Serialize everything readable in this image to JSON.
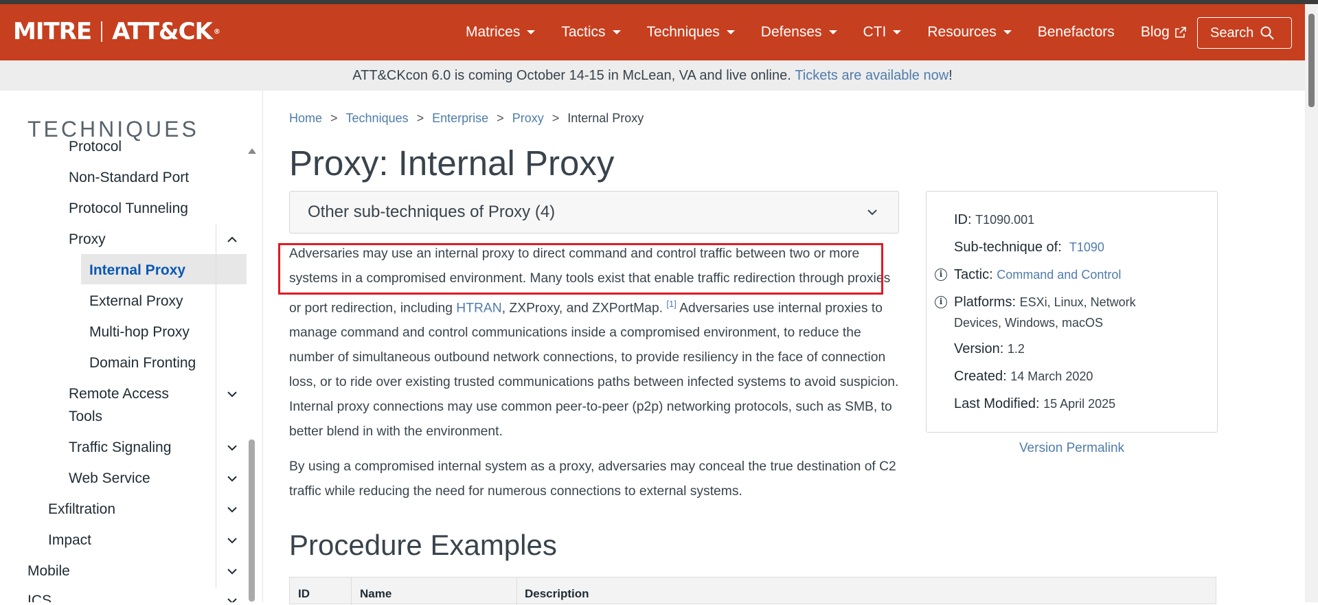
{
  "header": {
    "logo_mitre": "MITRE",
    "logo_attack": "ATT&CK",
    "logo_reg": "®",
    "nav": [
      {
        "label": "Matrices",
        "dropdown": true
      },
      {
        "label": "Tactics",
        "dropdown": true
      },
      {
        "label": "Techniques",
        "dropdown": true
      },
      {
        "label": "Defenses",
        "dropdown": true
      },
      {
        "label": "CTI",
        "dropdown": true
      },
      {
        "label": "Resources",
        "dropdown": true
      },
      {
        "label": "Benefactors",
        "dropdown": false
      },
      {
        "label": "Blog",
        "dropdown": false
      }
    ],
    "search_label": "Search",
    "brand_color": "#c63f1f"
  },
  "banner": {
    "text": "ATT&CKcon 6.0 is coming October 14-15 in McLean, VA and live online. ",
    "link": "Tickets are available now",
    "suffix": "!"
  },
  "sidebar": {
    "title": "TECHNIQUES",
    "items": [
      {
        "label": "Protocol"
      },
      {
        "label": "Non-Standard Port"
      },
      {
        "label": "Protocol Tunneling"
      },
      {
        "label": "Proxy"
      },
      {
        "label": "Internal Proxy",
        "active": true
      },
      {
        "label": "External Proxy"
      },
      {
        "label": "Multi-hop Proxy"
      },
      {
        "label": "Domain Fronting"
      },
      {
        "label": "Remote Access"
      },
      {
        "label": "Tools"
      },
      {
        "label": "Traffic Signaling"
      },
      {
        "label": "Web Service"
      },
      {
        "label": "Exfiltration"
      },
      {
        "label": "Impact"
      },
      {
        "label": "Mobile"
      },
      {
        "label": "ICS"
      }
    ]
  },
  "breadcrumb": {
    "items": [
      "Home",
      "Techniques",
      "Enterprise",
      "Proxy"
    ],
    "current": "Internal Proxy",
    "sep": ">"
  },
  "page": {
    "title": "Proxy: Internal Proxy",
    "accordion_label": "Other sub-techniques of Proxy (4)",
    "desc_part1": "Adversaries may use an internal proxy to direct command and control traffic between two or more systems in a compromised environment. Many tools exist that enable traffic redirection through proxies or port redirection, including ",
    "desc_link": "HTRAN",
    "desc_part2": ", ZXProxy, and ZXPortMap. ",
    "desc_ref": "[1]",
    "desc_part3": " Adversaries use internal proxies to manage command and control communications inside a compromised environment, to reduce the number of simultaneous outbound network connections, to provide resiliency in the face of connection loss, or to ride over existing trusted communications paths between infected systems to avoid suspicion. Internal proxy connections may use common peer-to-peer (p2p) networking protocols, such as SMB, to better blend in with the environment.",
    "desc2": "By using a compromised internal system as a proxy, adversaries may conceal the true destination of C2 traffic while reducing the need for numerous connections to external systems.",
    "procedure_heading": "Procedure Examples",
    "table_headers": [
      "ID",
      "Name",
      "Description"
    ]
  },
  "card": {
    "id_label": "ID:",
    "id_value": "T1090.001",
    "sub_label": "Sub-technique of:",
    "sub_value": "T1090",
    "tactic_label": "Tactic:",
    "tactic_value": "Command and Control",
    "platforms_label": "Platforms:",
    "platforms_line1": "ESXi, Linux, Network",
    "platforms_line2": "Devices, Windows, macOS",
    "version_label": "Version:",
    "version_value": "1.2",
    "created_label": "Created:",
    "created_value": "14 March 2020",
    "modified_label": "Last Modified:",
    "modified_value": "15 April 2025",
    "permalink": "Version Permalink"
  }
}
